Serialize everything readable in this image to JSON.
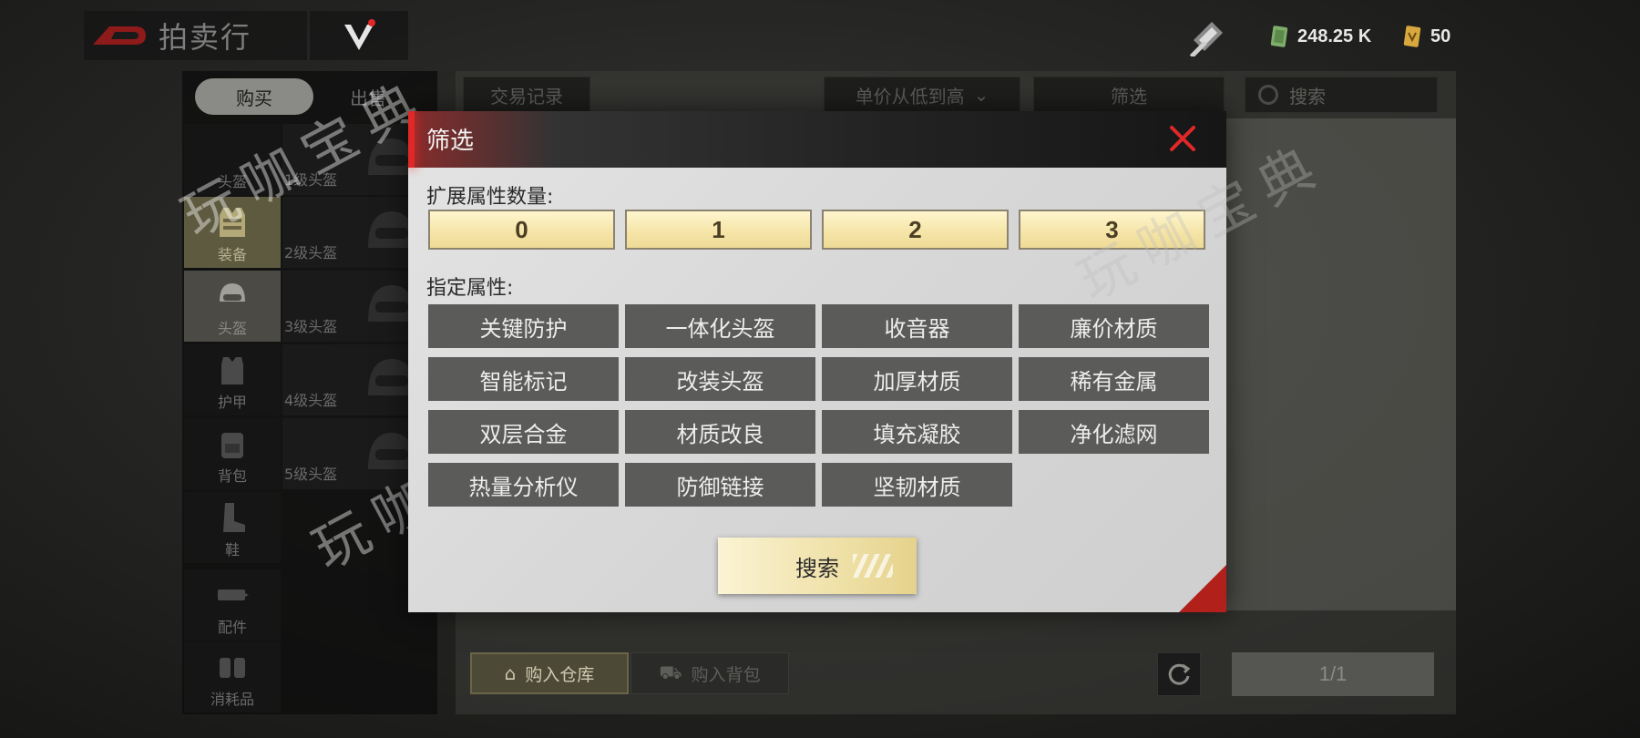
{
  "app": {
    "title": "拍卖行"
  },
  "currency": {
    "money": "248.25 K",
    "tickets": "50"
  },
  "tabs": {
    "buy": "购买",
    "sell": "出售"
  },
  "categories": [
    {
      "label": "头盔"
    },
    {
      "label": "装备"
    },
    {
      "label": "头盔"
    },
    {
      "label": "护甲"
    },
    {
      "label": "背包"
    },
    {
      "label": "鞋"
    },
    {
      "label": "配件"
    },
    {
      "label": "消耗品"
    }
  ],
  "subcategories": [
    "1级头盔",
    "2级头盔",
    "3级头盔",
    "4级头盔",
    "5级头盔"
  ],
  "toolbar": {
    "trade_record": "交易记录",
    "sort": "单价从低到高",
    "filter": "筛选",
    "search_placeholder": "搜索"
  },
  "bottom": {
    "buy_warehouse": "购入仓库",
    "buy_backpack": "购入背包",
    "page": "1/1"
  },
  "filter_modal": {
    "title": "筛选",
    "ext_label": "扩展属性数量:",
    "ext_options": [
      "0",
      "1",
      "2",
      "3"
    ],
    "attr_label": "指定属性:",
    "attributes": [
      "关键防护",
      "一体化头盔",
      "收音器",
      "廉价材质",
      "智能标记",
      "改装头盔",
      "加厚材质",
      "稀有金属",
      "双层合金",
      "材质改良",
      "填充凝胶",
      "净化滤网",
      "热量分析仪",
      "防御链接",
      "坚韧材质"
    ],
    "search_button": "搜索"
  },
  "watermark": "玩咖宝典",
  "colors": {
    "accent_red": "#e02828",
    "gold": "#f5e4a6",
    "attr_bg": "#5b5b59"
  }
}
